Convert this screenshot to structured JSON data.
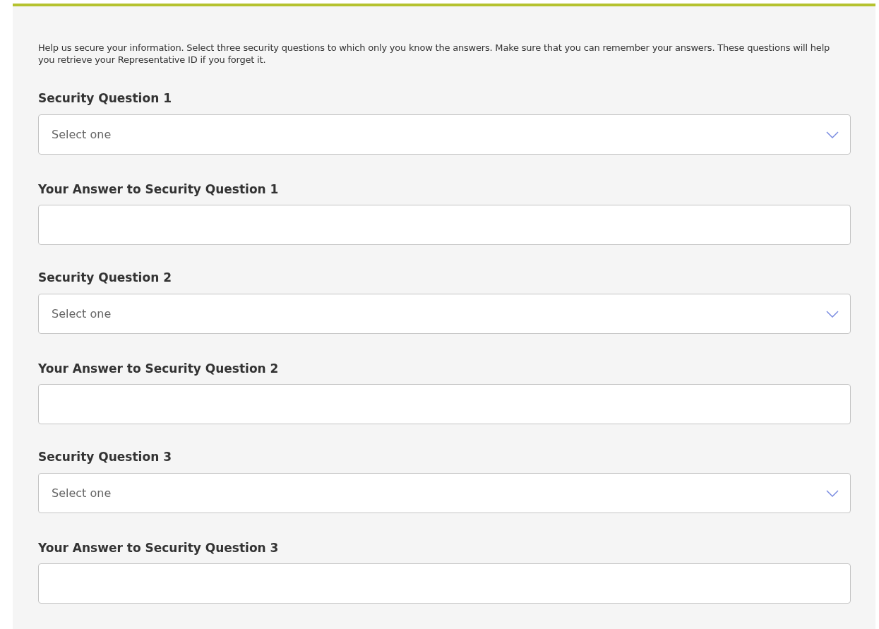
{
  "intro": "Help us secure your information. Select three security questions to which only you know the answers. Make sure that you can remember your answers. These questions will help you retrieve your Representative ID if you forget it.",
  "questions": [
    {
      "question_label": "Security Question 1",
      "select": {
        "placeholder": "Select one"
      },
      "answer_label": "Your Answer to Security Question 1"
    },
    {
      "question_label": "Security Question 2",
      "select": {
        "placeholder": "Select one"
      },
      "answer_label": "Your Answer to Security Question 2"
    },
    {
      "question_label": "Security Question 3",
      "select": {
        "placeholder": "Select one"
      },
      "answer_label": "Your Answer to Security Question 3"
    }
  ]
}
